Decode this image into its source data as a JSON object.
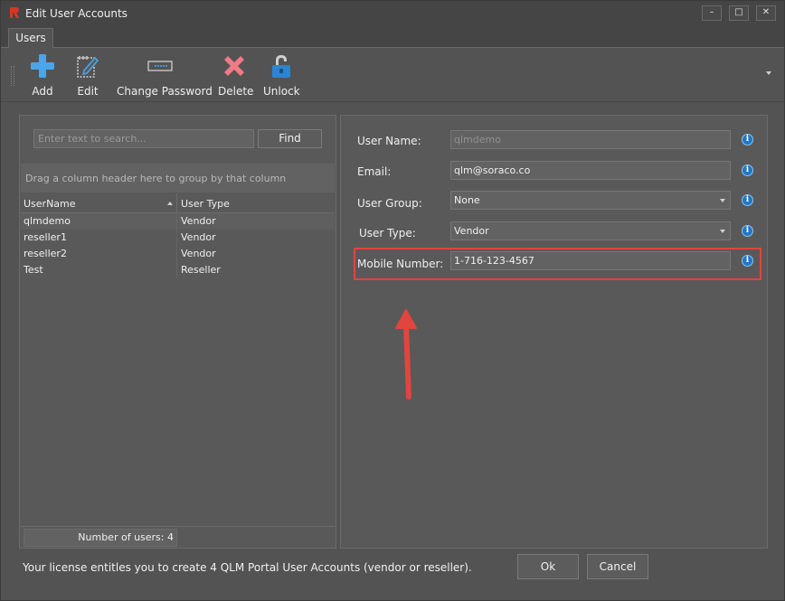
{
  "window": {
    "title": "Edit User Accounts"
  },
  "tabs": [
    {
      "label": "Users"
    }
  ],
  "toolbar": {
    "add_label": "Add",
    "edit_label": "Edit",
    "change_password_label": "Change Password",
    "delete_label": "Delete",
    "unlock_label": "Unlock"
  },
  "search": {
    "placeholder": "Enter text to search...",
    "value": "",
    "find_label": "Find"
  },
  "grid": {
    "group_hint": "Drag a column header here to group by that column",
    "columns": [
      "UserName",
      "User Type"
    ],
    "rows": [
      {
        "username": "qlmdemo",
        "user_type": "Vendor"
      },
      {
        "username": "reseller1",
        "user_type": "Vendor"
      },
      {
        "username": "reseller2",
        "user_type": "Vendor"
      },
      {
        "username": "Test",
        "user_type": "Reseller"
      }
    ],
    "footer": "Number of users: 4"
  },
  "form": {
    "user_name": {
      "label": "User Name:",
      "value": "qlmdemo"
    },
    "email": {
      "label": "Email:",
      "value": "qlm@soraco.co"
    },
    "user_group": {
      "label": "User Group:",
      "value": "None"
    },
    "user_type": {
      "label": "User Type:",
      "value": "Vendor"
    },
    "mobile_number": {
      "label": "Mobile Number:",
      "value": "1-716-123-4567"
    }
  },
  "footer": {
    "license_text": "Your license entitles you to create 4 QLM Portal User Accounts (vendor or reseller).",
    "ok_label": "Ok",
    "cancel_label": "Cancel"
  },
  "colors": {
    "highlight": "#e0453f",
    "info": "#1f78c8",
    "add": "#4aa6e8",
    "delete": "#f07a86"
  }
}
